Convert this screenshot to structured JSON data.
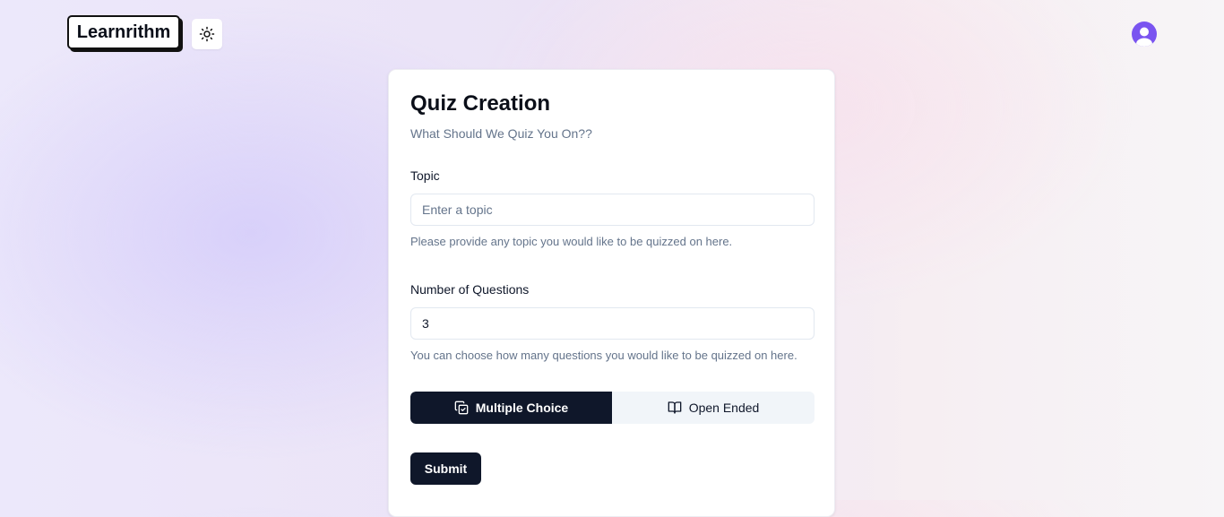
{
  "header": {
    "logo_text": "Learnrithm",
    "theme_toggle_icon": "sun-icon",
    "avatar_icon": "user-avatar-icon"
  },
  "card": {
    "title": "Quiz Creation",
    "subtitle": "What Should We Quiz You On??",
    "topic": {
      "label": "Topic",
      "placeholder": "Enter a topic",
      "value": "",
      "help": "Please provide any topic you would like to be quizzed on here."
    },
    "questions": {
      "label": "Number of Questions",
      "value": "3",
      "help": "You can choose how many questions you would like to be quizzed on here."
    },
    "type_toggle": {
      "selected": "Multiple Choice",
      "options": [
        {
          "label": "Multiple Choice",
          "icon": "copy-check-icon"
        },
        {
          "label": "Open Ended",
          "icon": "book-open-icon"
        }
      ]
    },
    "submit_label": "Submit"
  },
  "colors": {
    "primary_dark": "#0f172a",
    "avatar": "#7a54f0",
    "muted_text": "#64748b"
  }
}
